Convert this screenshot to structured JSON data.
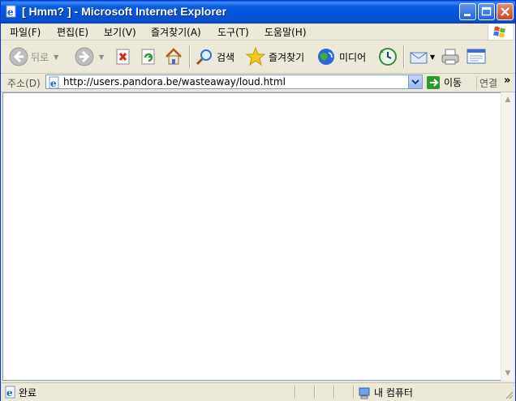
{
  "window": {
    "title": "[ Hmm? ] - Microsoft Internet Explorer",
    "colors": {
      "titlebar": "#0553d8",
      "close": "#c7472a",
      "chrome": "#ece9d8"
    }
  },
  "menu": {
    "items": [
      "파일(F)",
      "편집(E)",
      "보기(V)",
      "즐겨찾기(A)",
      "도구(T)",
      "도움말(H)"
    ]
  },
  "toolbar": {
    "back_label": "뒤로",
    "search_label": "검색",
    "favorites_label": "즐겨찾기",
    "media_label": "미디어"
  },
  "address": {
    "label": "주소(D)",
    "url": "http://users.pandora.be/wasteaway/loud.html",
    "go_label": "이동",
    "links_label": "연결",
    "more": "»"
  },
  "status": {
    "text": "완료",
    "zone": "내 컴퓨터"
  }
}
